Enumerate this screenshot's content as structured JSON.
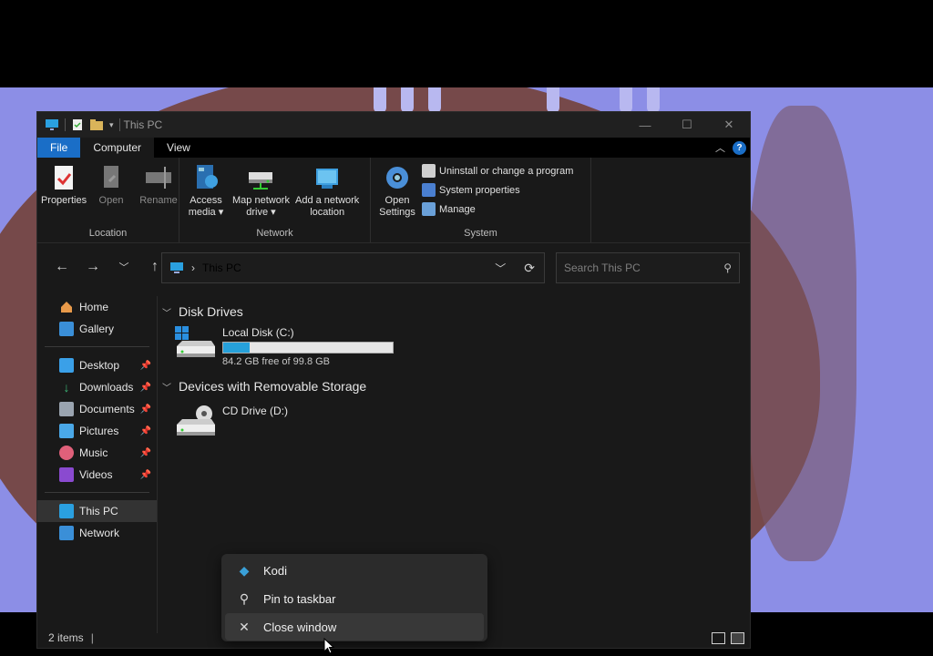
{
  "window": {
    "title": "This PC"
  },
  "ribbon": {
    "tabs": [
      "File",
      "Computer",
      "View"
    ],
    "groups": {
      "location": {
        "label": "Location",
        "properties": "Properties",
        "open": "Open",
        "rename": "Rename"
      },
      "network": {
        "label": "Network",
        "access_media_1": "Access",
        "access_media_2": "media",
        "map_drive_1": "Map network",
        "map_drive_2": "drive",
        "add_location_1": "Add a network",
        "add_location_2": "location"
      },
      "system": {
        "label": "System",
        "open_settings_1": "Open",
        "open_settings_2": "Settings",
        "uninstall": "Uninstall or change a program",
        "system_properties": "System properties",
        "manage": "Manage"
      }
    }
  },
  "address": {
    "path": "This PC",
    "search_placeholder": "Search This PC"
  },
  "sidebar": {
    "items": [
      {
        "label": "Home"
      },
      {
        "label": "Gallery"
      },
      {
        "label": "Desktop"
      },
      {
        "label": "Downloads"
      },
      {
        "label": "Documents"
      },
      {
        "label": "Pictures"
      },
      {
        "label": "Music"
      },
      {
        "label": "Videos"
      },
      {
        "label": "This PC"
      },
      {
        "label": "Network"
      }
    ]
  },
  "content": {
    "disk_drives_heading": "Disk Drives",
    "local_disk": {
      "name": "Local Disk (C:)",
      "free_text": "84.2 GB free of 99.8 GB",
      "used_fraction": 0.156
    },
    "removable_heading": "Devices with Removable Storage",
    "cd_drive": {
      "name": "CD Drive (D:)"
    }
  },
  "status": {
    "items_count": "2 items"
  },
  "context_menu": {
    "items": [
      "Kodi",
      "Pin to taskbar",
      "Close window"
    ]
  },
  "colors": {
    "accent": "#1a6ec7",
    "progress": "#26a0da"
  }
}
